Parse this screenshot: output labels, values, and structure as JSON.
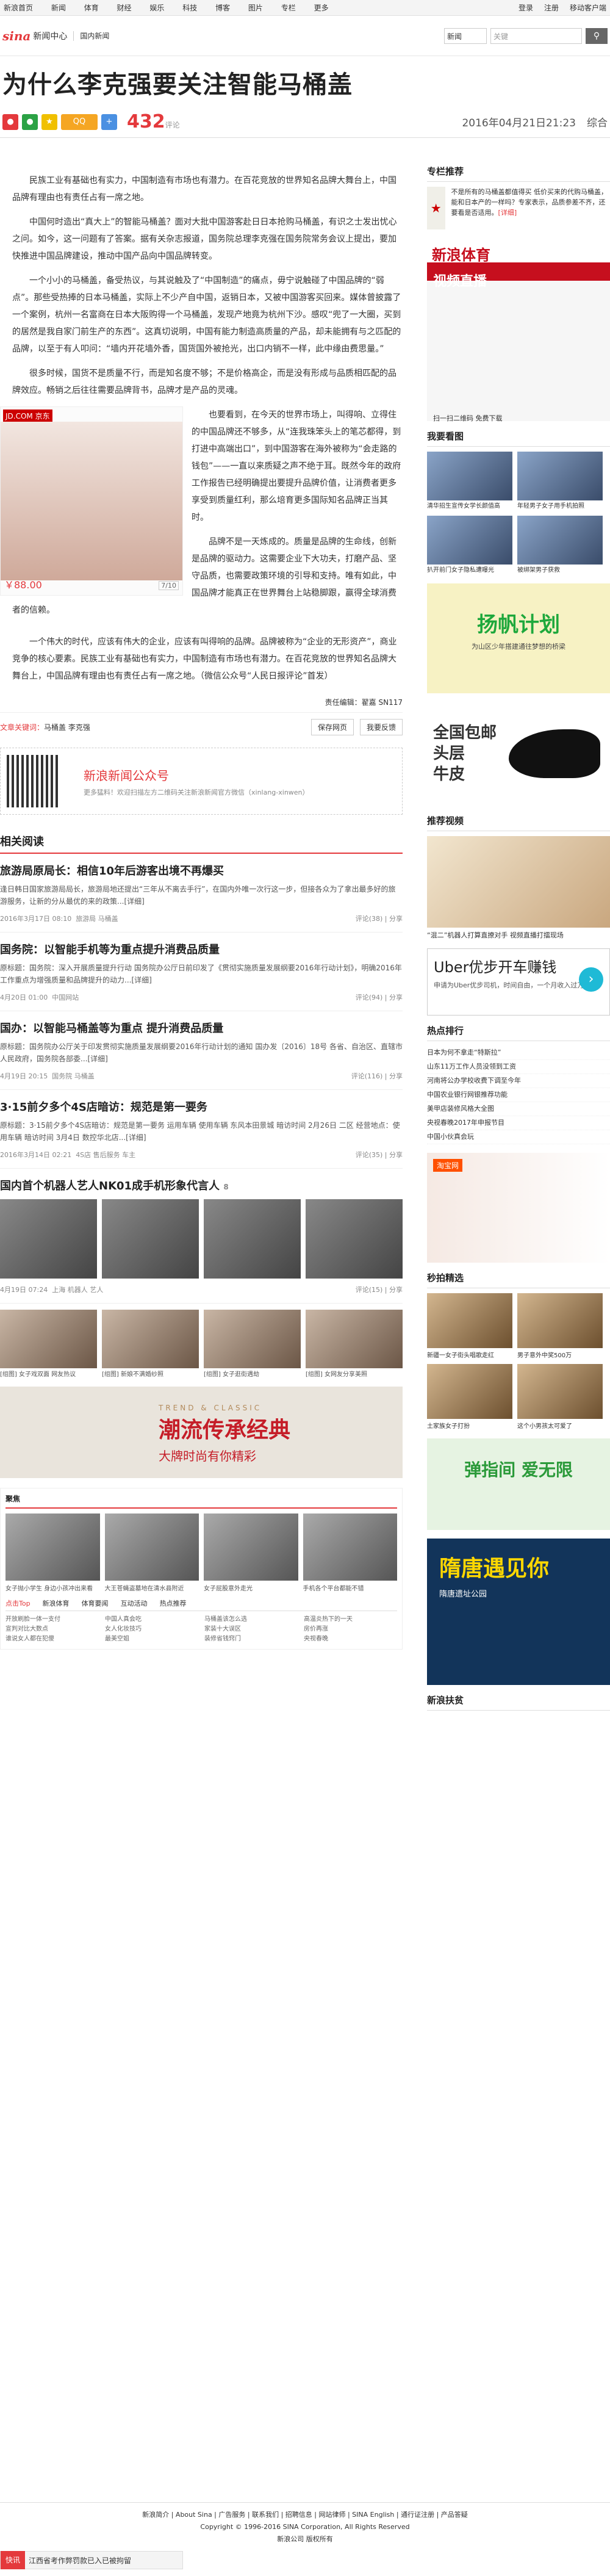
{
  "topnav": {
    "items": [
      "新浪首页",
      "新闻",
      "体育",
      "财经",
      "娱乐",
      "科技",
      "博客",
      "图片",
      "专栏",
      "更多"
    ],
    "right": [
      "登录",
      "注册",
      "移动客户端"
    ]
  },
  "header": {
    "logo": "sina",
    "logo_sub": "新闻中心",
    "crumb": "国内新闻",
    "search_select": "新闻",
    "search_placeholder": "关键"
  },
  "article": {
    "title": "为什么李克强要关注智能马桶盖",
    "comment_count": "432",
    "comment_label": "评论",
    "date": "2016年04月21日21:23",
    "source": "综合",
    "paragraphs": [
      "民族工业有基础也有实力，中国制造有市场也有潜力。在百花竞放的世界知名品牌大舞台上，中国品牌有理由也有责任占有一席之地。",
      "中国何时造出“真大上”的智能马桶盖？面对大批中国游客赴日日本抢购马桶盖，有识之士发出忧心之问。如今，这一问题有了答案。据有关杂志报道，国务院总理李克强在国务院常务会议上提出，要加快推进中国品牌建设，推动中国产品向中国品牌转变。",
      "一个小小的马桶盖，备受热议，与其说触及了“中国制造”的痛点，毋宁说触碰了中国品牌的“弱点”。那些受热捧的日本马桶盖，实际上不少产自中国，返销日本，又被中国游客买回来。媒体曾披露了一个案例，杭州一名富商在日本大阪购得一个马桶盖，发现产地竟为杭州下沙。感叹“兜了一大圈，买到的居然是我自家门前生产的东西”。这真切说明，中国有能力制造高质量的产品，却未能拥有与之匹配的品牌，以至于有人叩问：“墙内开花墙外香，国货国外被抢光，出口内销不一样，此中缘由费思量。”",
      "很多时候，国货不是质量不行，而是知名度不够；不是价格高企，而是没有形成与品质相匹配的品牌效应。畅销之后往往需要品牌背书，品牌才是产品的灵魂。",
      "也要看到，在今天的世界市场上，叫得响、立得住的中国品牌还不够多，从“连我珠笨头上的笔芯都得，到打进中高端出口”，到中国游客在海外被称为“会走路的钱包”——一直以来质疑之声不绝于耳。既然今年的政府工作报告已经明确提出要提升品牌价值，让消费者更多享受到质量红利，那么培育更多国际知名品牌正当其时。",
      "品牌不是一天炼成的。质量是品牌的生命线，创新是品牌的驱动力。这需要企业下大功夫，打磨产品、坚守品质，也需要政策环境的引导和支持。唯有如此，中国品牌才能真正在世界舞台上站稳脚跟，赢得全球消费者的信赖。",
      "一个伟大的时代，应该有伟大的企业，应该有叫得响的品牌。品牌被称为“企业的无形资产”，商业竞争的核心要素。民族工业有基础也有实力，中国制造有市场也有潜力。在百花竞放的世界知名品牌大舞台上，中国品牌有理由也有责任占有一席之地。（微信公众号“人民日报评论”首发）"
    ],
    "ad": {
      "tag": "JD.COM 京东",
      "price": "￥88.00",
      "page": "7/10"
    },
    "editor": "责任编辑：翟嘉 SN117",
    "keywords_label": "文章关键词：",
    "keywords": "马桶盖 李克强",
    "save_label": "保存网页",
    "report_label": "我要反馈"
  },
  "qr": {
    "title": "新浪新闻公众号",
    "desc": "更多猛料！欢迎扫描左方二维码关注新浪新闻官方微信（xinlang-xinwen）"
  },
  "related": {
    "heading": "相关阅读",
    "items": [
      {
        "title": "旅游局原局长：相信10年后游客出境不再爆买",
        "desc": "逢日韩日国家旅游局局长，旅游局地还提出“三年从不离去手行”，在国内外唯一次行这一步，但接各众为了拿出最多好的旅游服务，让新的分从最优的来的政策...[详细]",
        "date": "2016年3月17日 08:10",
        "tags": "旅游局 马桶盖",
        "comments": "评论(38)",
        "share": "分享"
      },
      {
        "title": "国务院：以智能手机等为重点提升消费品质量",
        "desc": "原标题：国务院：深入开展质量提升行动 国务院办公厅日前印发了《贯彻实施质量发展纲要2016年行动计划》，明确2016年工作重点为增强质量和品牌提升的动力...[详细]",
        "date": "4月20日 01:00",
        "tags": "中国网站",
        "comments": "评论(94)",
        "share": "分享"
      },
      {
        "title": "国办：以智能马桶盖等为重点 提升消费品质量",
        "desc": "原标题：国务院办公厅关于印发贯彻实施质量发展纲要2016年行动计划的通知 国办发〔2016〕18号 各省、自治区、直辖市人民政府，国务院各部委...[详细]",
        "date": "4月19日 20:15",
        "tags": "国务院 马桶盖",
        "comments": "评论(116)",
        "share": "分享"
      },
      {
        "title": "3·15前夕多个4S店暗访：规范是第一要务",
        "desc": "原标题：3·15前夕多个4S店暗访：规范是第一要务 运用车辆 使用车辆 东风本田景城 暗访时间 2月26日 二区 经营地点：使用车辆 暗访时间 3月4日 数控华北店...[详细]",
        "date": "2016年3月14日 02:21",
        "tags": "4S店 售后服务 车主",
        "comments": "评论(35)",
        "share": "分享"
      }
    ],
    "photo_item": {
      "title": "国内首个机器人艺人NK01成手机形象代言人",
      "count": "8",
      "date": "4月19日 07:24",
      "tags": "上海 机器人 艺人",
      "comments": "评论(15)",
      "share": "分享"
    },
    "thumbs": [
      "[组图] 女子戏双面 网友热议",
      "[组图] 新娘不满婚纱照",
      "[组图] 女子逛街遇劫",
      "[组图] 女网友分享美照"
    ],
    "banner": {
      "a": "TREND & CLASSIC",
      "b": "潮流传承经典",
      "c": "大牌时尚有你精彩"
    },
    "gallery_heading": "聚焦",
    "gallery": [
      "女子抛小学生 身边小孩冲出来看",
      "大王苍蝇盗墓地在清水县附近",
      "女子屁股意外走光",
      "手机各个平台都能不错"
    ],
    "tabs": [
      "点击Top",
      "新浪体育",
      "体育要闻",
      "互动活动",
      "热点推荐"
    ],
    "list_cols": [
      [
        "开放刷脸一体一支付",
        "宣判对比大数点",
        "谁说女人都在犯傻"
      ],
      [
        "中国人真会吃",
        "女人化妆技巧",
        "最美空姐"
      ],
      [
        "马桶盖该怎么选",
        "家装十大误区",
        "装修省钱窍门"
      ],
      [
        "高温炎热下的一天",
        "房价再涨",
        "央视春晚"
      ]
    ]
  },
  "side": {
    "rec_heading": "专栏推荐",
    "rec_text": "不是所有的马桶盖都值得买 低价买来的代购马桶盖，能和日本产的一样吗？专家表示，品质参差不齐，还要看是否适用。",
    "rec_more": "[详细]",
    "sport_ad": {
      "a": "新浪体育",
      "b": "视频直播",
      "c": "扫一扫二维码 免费下载"
    },
    "pics_heading": "我要看图",
    "pics": [
      "清华招生宣传女学长颜值高",
      "年轻男子女子用手机拍照",
      "扒开前门女子隐私遭曝光",
      "被绑架男子获救"
    ],
    "yellow_ad": {
      "a": "扬帆计划",
      "b": "为山区少年搭建通往梦想的桥梁"
    },
    "shoe_ad": {
      "a": "全国包邮",
      "b": "头层",
      "c": "牛皮"
    },
    "video_heading": "推荐视频",
    "video_caption": "“混二”机器人打算直撩对手 视频直播打擂现场",
    "uber": {
      "a": "Uber优步开车赚钱",
      "b": "申请为Uber优步司机，时间自由，一个月收入过万"
    },
    "hot_heading": "热点排行",
    "hot": [
      "日本为何不拿走“特斯拉”",
      "山东11万工作人员没领到工资",
      "河南将公办学校收费下调至今年",
      "中国农业银行网银推荐功能",
      "美甲店装修风格大全图",
      "央视春晚2017年申报节目",
      "中国小伙真会玩"
    ],
    "taobao_tag": "淘宝网",
    "shop_heading": "秒拍精选",
    "shop": [
      "新疆一女子街头唱歌走红",
      "男子意外中奖500万",
      "土家族女子打扮",
      "这个小男孩太可爱了"
    ],
    "green_ad": "弹指间 爱无限",
    "blue_ad": {
      "a": "隋唐遇见你",
      "b": "隋唐遗址公园"
    },
    "news_heading": "新浪扶贫"
  },
  "footer": {
    "links": "新浪简介 | About Sina | 广告服务 | 联系我们 | 招聘信息 | 网站律师 | SINA English | 通行证注册 | 产品答疑",
    "copyright": "Copyright © 1996-2016 SINA Corporation, All Rights Reserved",
    "sub": "新浪公司 版权所有"
  },
  "floatbar": {
    "label": "快讯",
    "text": "江西省考作弊罚款已入已被拘留"
  }
}
